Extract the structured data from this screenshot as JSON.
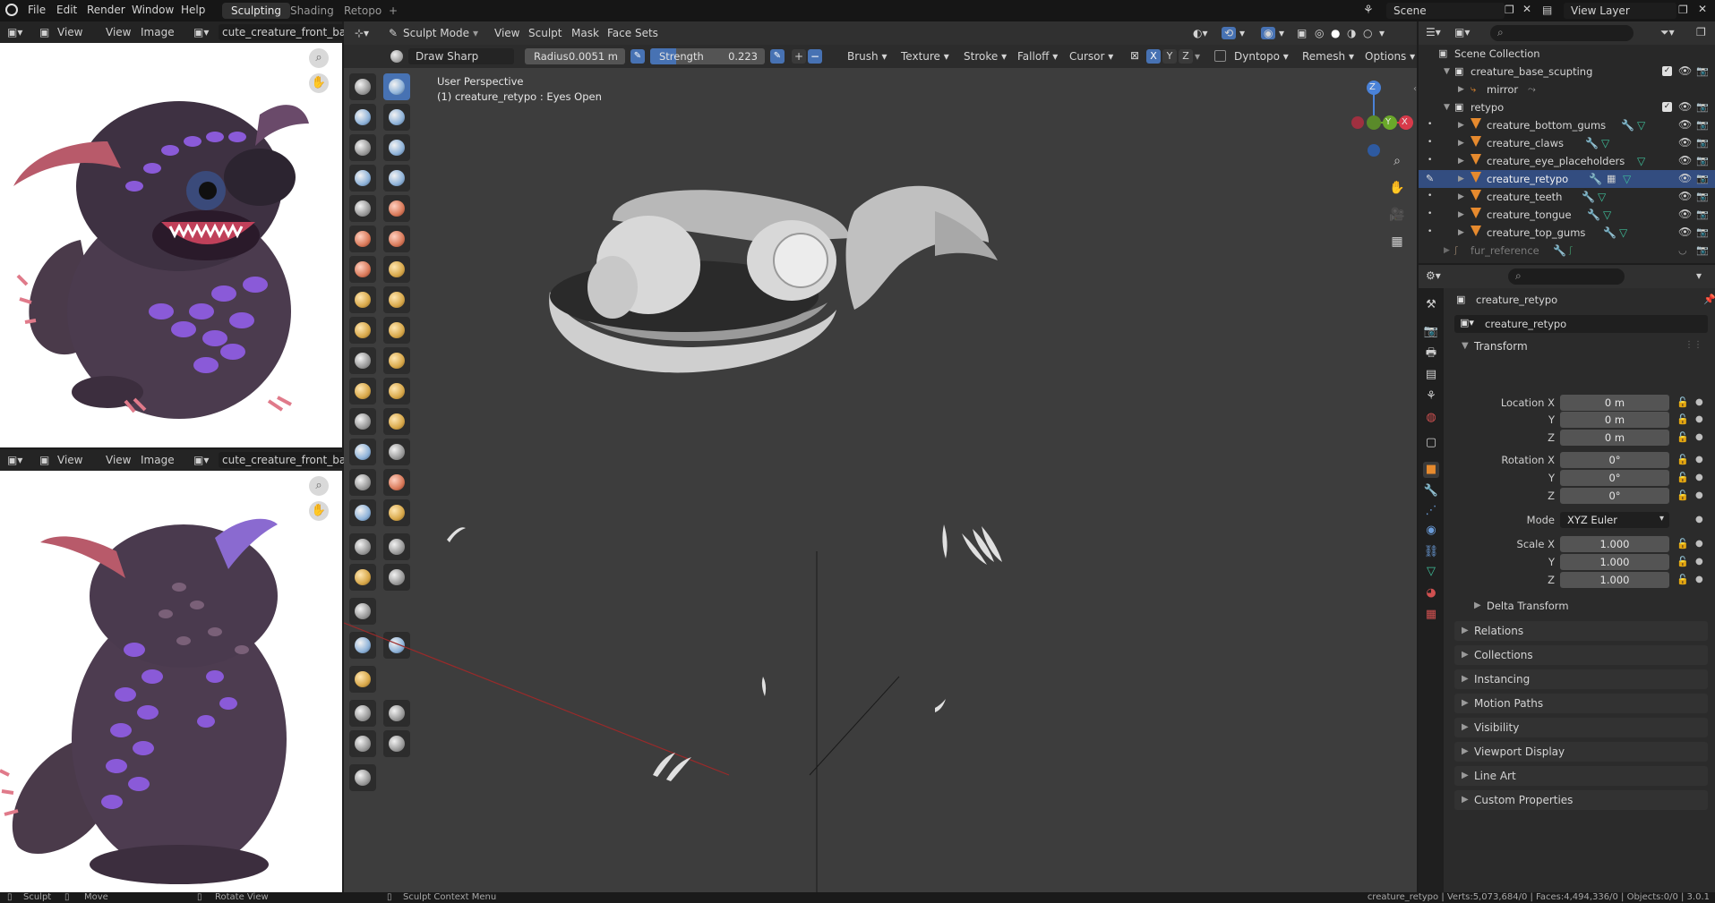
{
  "topbar": {
    "menus": [
      "File",
      "Edit",
      "Render",
      "Window",
      "Help"
    ],
    "workspaces": [
      "Sculpting",
      "Shading",
      "Retopo",
      "+"
    ],
    "scene_name": "Scene",
    "view_layer": "View Layer"
  },
  "image_editor_top": {
    "menus": [
      "View",
      "View",
      "Image"
    ],
    "image_name": "cute_creature_front_back."
  },
  "image_editor_bottom": {
    "menus": [
      "View",
      "View",
      "Image"
    ],
    "image_name": "cute_creature_front_back."
  },
  "viewport": {
    "mode": "Sculpt Mode",
    "menus": [
      "View",
      "Sculpt",
      "Mask",
      "Face Sets"
    ],
    "brush_name": "Draw Sharp",
    "radius_label": "Radius",
    "radius_value": "0.0051 m",
    "strength_label": "Strength",
    "strength_value": "0.223",
    "strength_fraction": 0.223,
    "dropdowns": [
      "Brush",
      "Texture",
      "Stroke",
      "Falloff",
      "Cursor"
    ],
    "symmetry": [
      "X",
      "Y",
      "Z"
    ],
    "dropdowns_right": [
      "Dyntopo",
      "Remesh",
      "Options"
    ],
    "overlay_line1": "User Perspective",
    "overlay_line2": "(1) creature_retypo : Eyes Open",
    "gizmo": {
      "z": "Z",
      "x": "X",
      "y": "Y"
    }
  },
  "outliner": {
    "root": "Scene Collection",
    "items": [
      {
        "label": "creature_base_scupting"
      },
      {
        "label": "mirror"
      },
      {
        "label": "retypo"
      },
      {
        "label": "creature_bottom_gums"
      },
      {
        "label": "creature_claws"
      },
      {
        "label": "creature_eye_placeholders"
      },
      {
        "label": "creature_retypo"
      },
      {
        "label": "creature_teeth"
      },
      {
        "label": "creature_tongue"
      },
      {
        "label": "creature_top_gums"
      },
      {
        "label": "fur_reference"
      }
    ]
  },
  "properties": {
    "object_name": "creature_retypo",
    "datablock_name": "creature_retypo",
    "transform_title": "Transform",
    "location_x_label": "Location X",
    "rotation_x_label": "Rotation X",
    "scale_x_label": "Scale X",
    "axis_y": "Y",
    "axis_z": "Z",
    "location": [
      "0 m",
      "0 m",
      "0 m"
    ],
    "rotation": [
      "0°",
      "0°",
      "0°"
    ],
    "mode_label": "Mode",
    "mode_value": "XYZ Euler",
    "scale": [
      "1.000",
      "1.000",
      "1.000"
    ],
    "delta_transform": "Delta Transform",
    "panels": [
      "Relations",
      "Collections",
      "Instancing",
      "Motion Paths",
      "Visibility",
      "Viewport Display",
      "Line Art",
      "Custom Properties"
    ]
  },
  "status": {
    "left_items": [
      "Sculpt",
      "Move",
      "Rotate View",
      "Sculpt Context Menu"
    ],
    "right_text": "creature_retypo | Verts:5,073,684/0 | Faces:4,494,336/0 | Objects:0/0 | 3.0.1"
  }
}
